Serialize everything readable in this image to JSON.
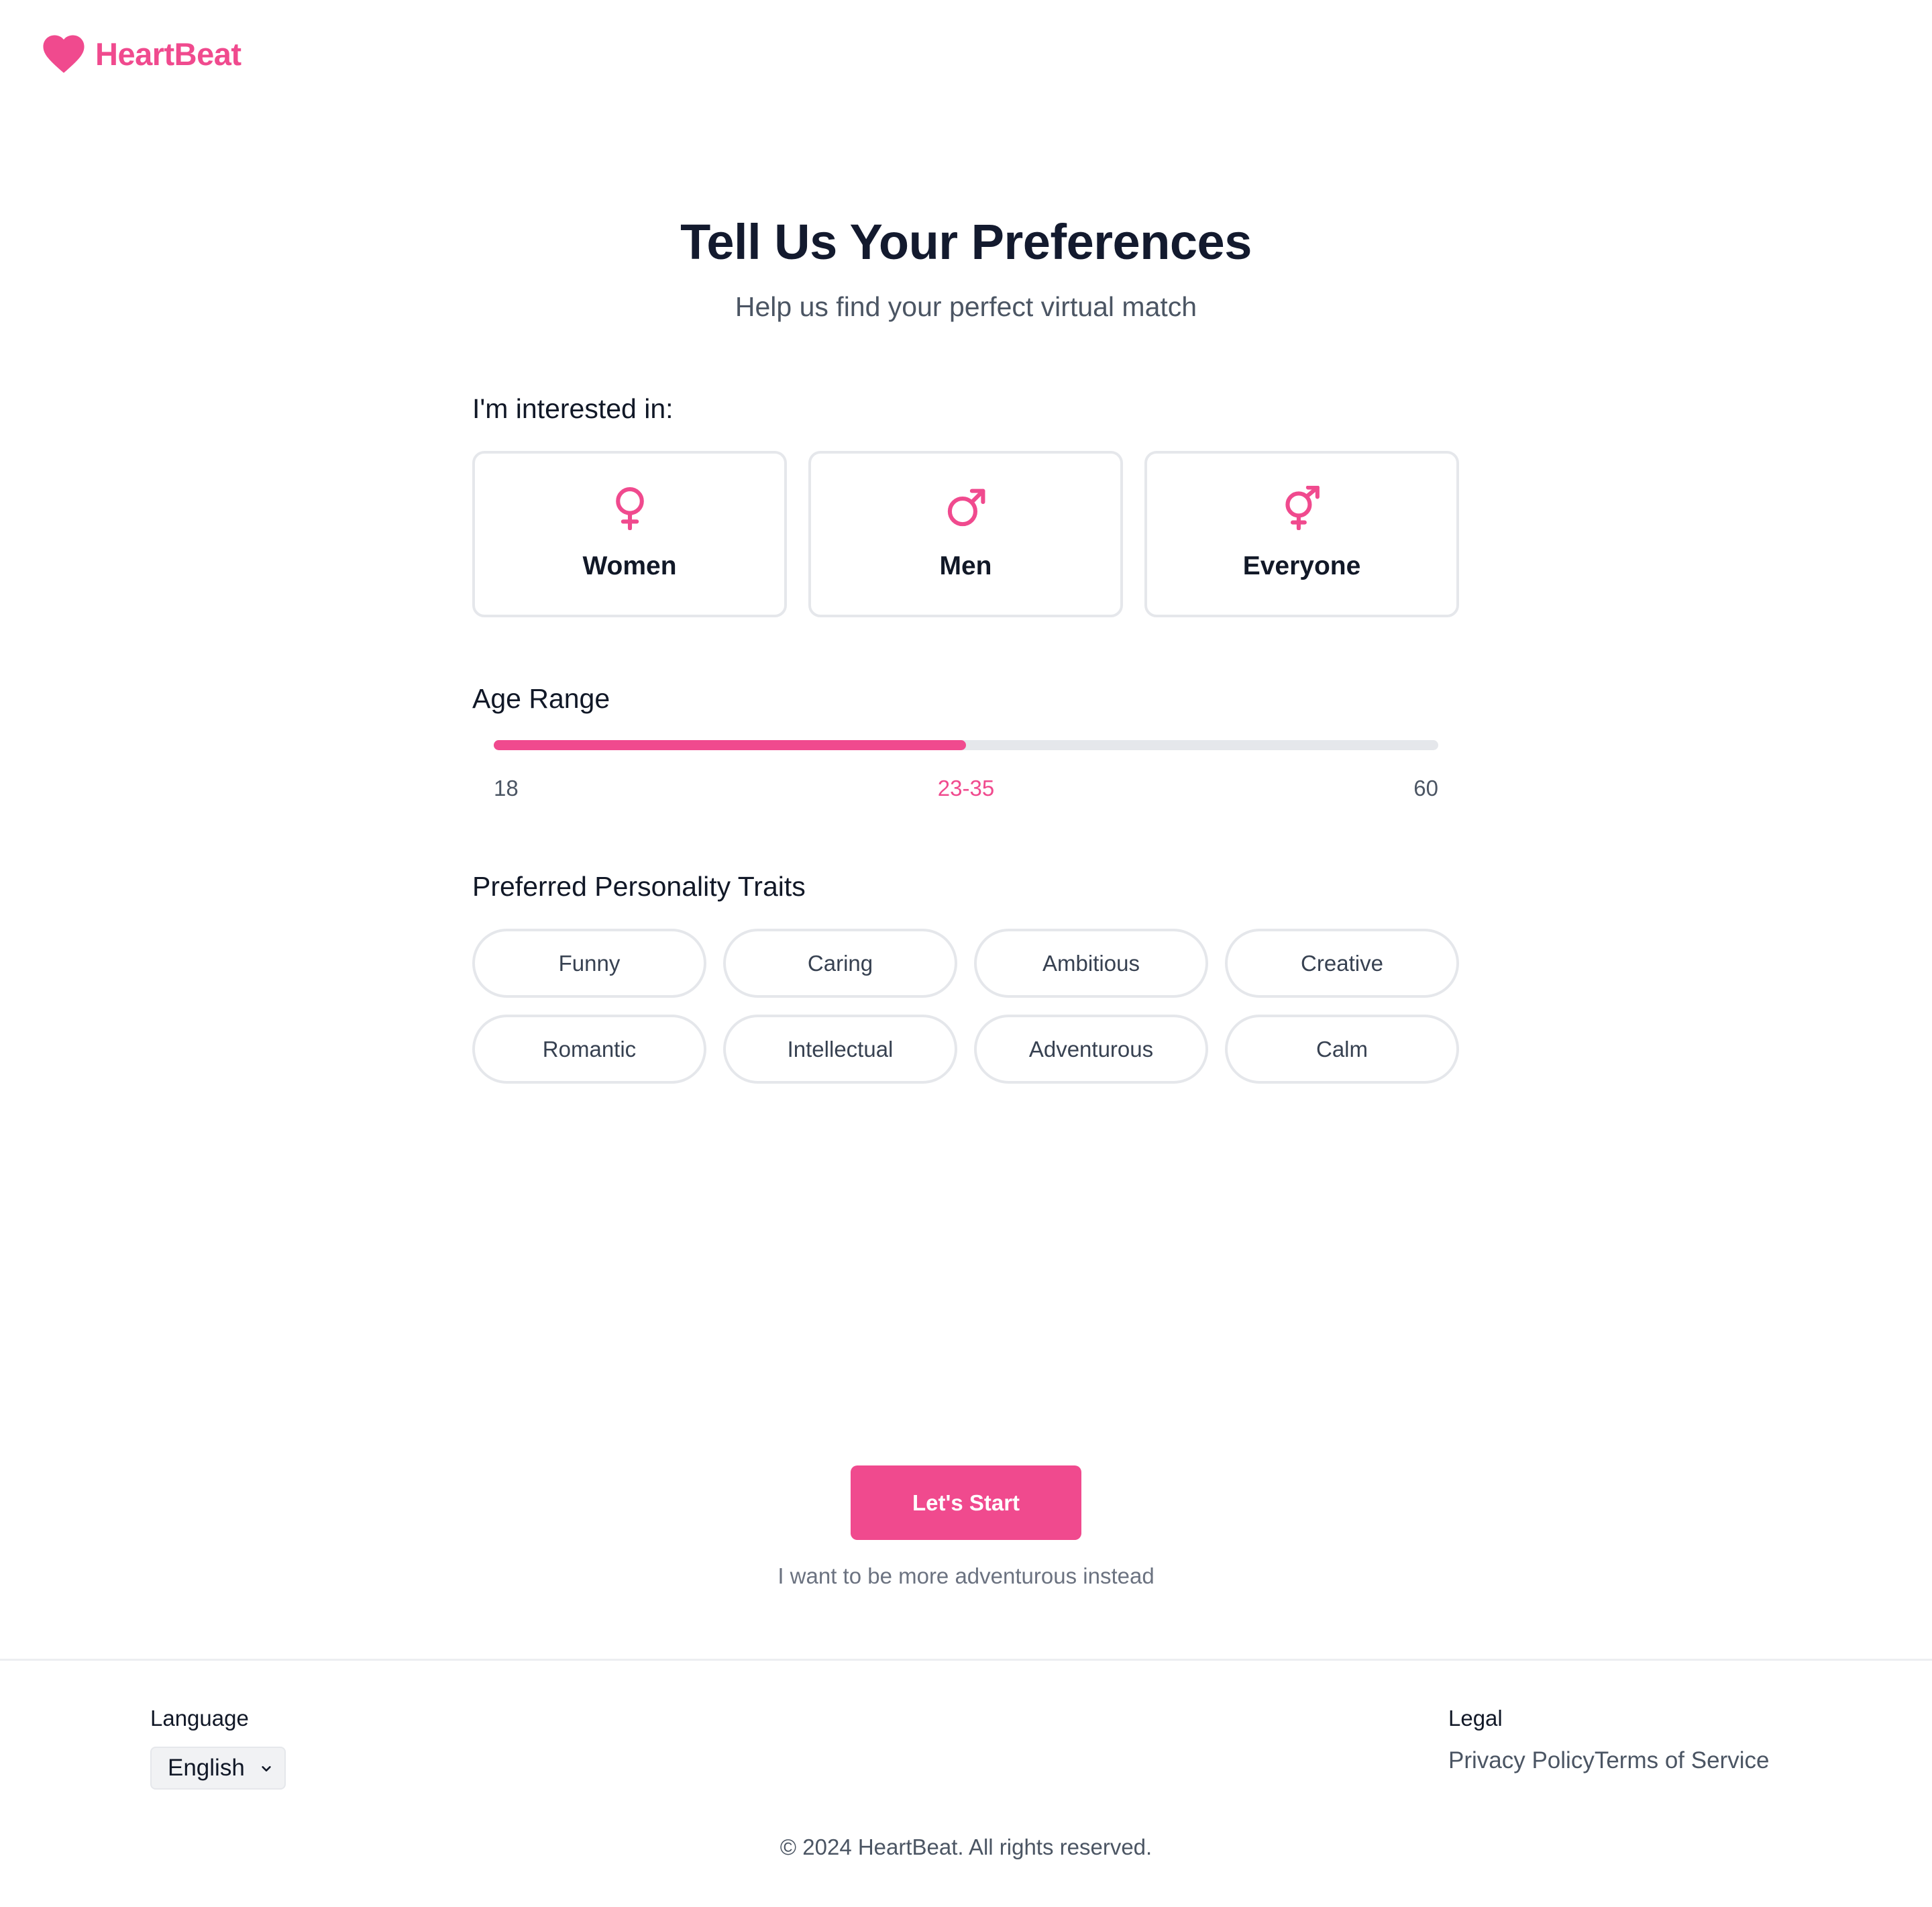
{
  "brand": {
    "name": "HeartBeat",
    "logo_icon": "heart-icon",
    "accent_color": "#f04a8e"
  },
  "hero": {
    "title": "Tell Us Your Preferences",
    "subtitle": "Help us find your perfect virtual match"
  },
  "interest": {
    "label": "I'm interested in:",
    "options": [
      {
        "label": "Women",
        "icon": "female-symbol-icon"
      },
      {
        "label": "Men",
        "icon": "male-symbol-icon"
      },
      {
        "label": "Everyone",
        "icon": "transgender-symbol-icon"
      }
    ]
  },
  "age_range": {
    "label": "Age Range",
    "min_label": "18",
    "max_label": "60",
    "value_label": "23-35",
    "fill_fraction": 0.5
  },
  "traits": {
    "label": "Preferred Personality Traits",
    "items": [
      "Funny",
      "Caring",
      "Ambitious",
      "Creative",
      "Romantic",
      "Intellectual",
      "Adventurous",
      "Calm"
    ]
  },
  "actions": {
    "start_label": "Let's Start",
    "alt_link": "I want to be more adventurous instead"
  },
  "footer": {
    "language_heading": "Language",
    "language_selected": "English",
    "legal_heading": "Legal",
    "privacy_label": "Privacy Policy",
    "terms_label": "Terms of Service",
    "copyright": "© 2024 HeartBeat. All rights reserved."
  }
}
